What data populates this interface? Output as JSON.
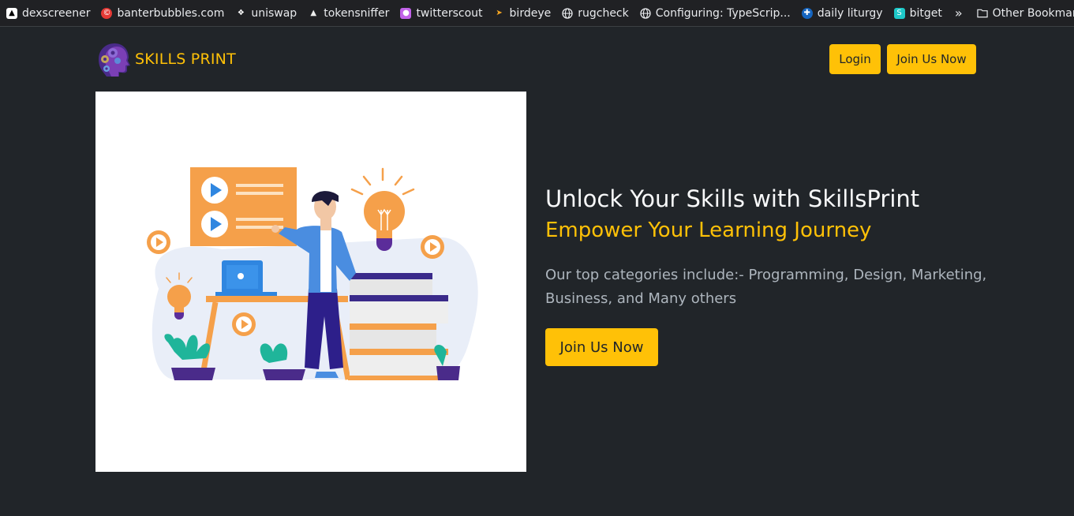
{
  "bookmarks": {
    "items": [
      {
        "label": "dexscreener",
        "icon": "dexscreener-icon",
        "color": "#ffffff"
      },
      {
        "label": "banterbubbles.com",
        "icon": "banterbubbles-icon",
        "color": "#e53935"
      },
      {
        "label": "uniswap",
        "icon": "uniswap-icon",
        "color": "#ffffff"
      },
      {
        "label": "tokensniffer",
        "icon": "tokensniffer-icon",
        "color": "#222222"
      },
      {
        "label": "twitterscout",
        "icon": "twitterscout-icon",
        "color": "#c162e8"
      },
      {
        "label": "birdeye",
        "icon": "birdeye-icon",
        "color": "#f5a623"
      },
      {
        "label": "rugcheck",
        "icon": "globe-icon",
        "color": "#e8eaed"
      },
      {
        "label": "Configuring: TypeScrip...",
        "icon": "globe-icon",
        "color": "#e8eaed"
      },
      {
        "label": "daily liturgy",
        "icon": "liturgy-icon",
        "color": "#1565c0"
      },
      {
        "label": "bitget",
        "icon": "bitget-icon",
        "color": "#1ec8c8"
      }
    ],
    "overflow_icon": "chevron-double-right-icon",
    "other_label": "Other Bookmarks"
  },
  "navbar": {
    "brand": "SKILLS PRINT",
    "login_label": "Login",
    "join_label": "Join Us Now"
  },
  "hero": {
    "title": "Unlock Your Skills with SkillsPrint",
    "subtitle": "Empower Your Learning Journey",
    "description": "Our top categories include:- Programming, Design, Marketing, Business, and Many others",
    "cta_label": "Join Us Now"
  },
  "colors": {
    "accent": "#ffc107",
    "background": "#212529"
  }
}
